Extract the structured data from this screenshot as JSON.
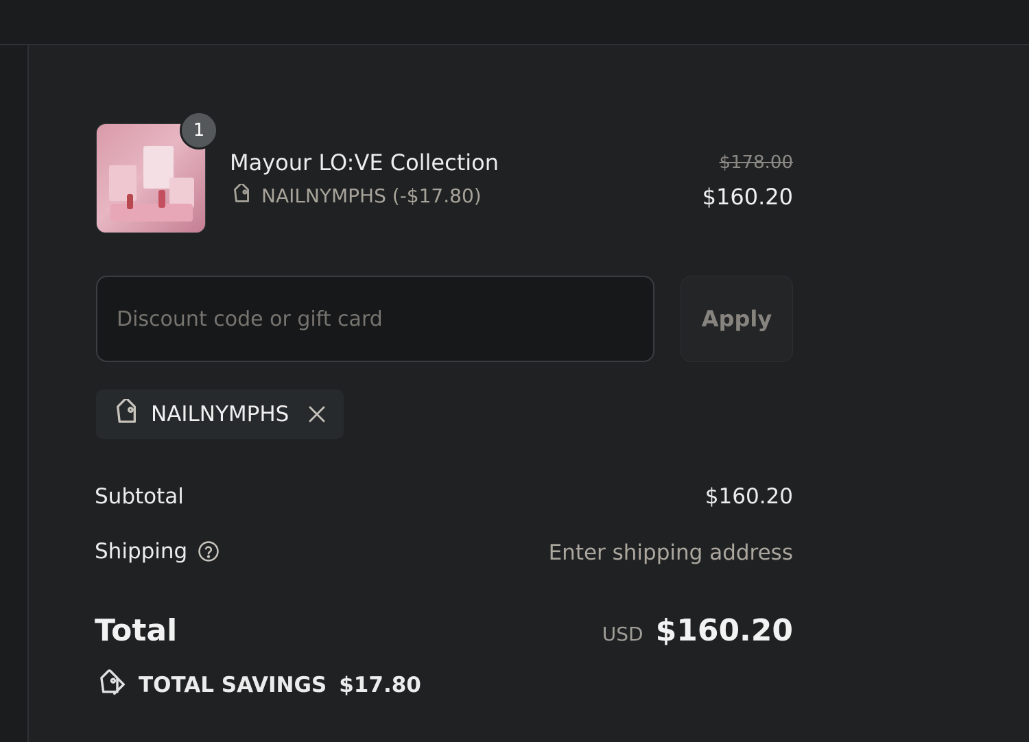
{
  "line_item": {
    "quantity": "1",
    "name": "Mayour LO:VE Collection",
    "discount_note": "NAILNYMPHS (-$17.80)",
    "original_price": "$178.00",
    "price": "$160.20"
  },
  "discount": {
    "placeholder": "Discount code or gift card",
    "value": "",
    "apply_label": "Apply"
  },
  "applied_code": {
    "code": "NAILNYMPHS"
  },
  "summary": {
    "subtotal_label": "Subtotal",
    "subtotal_value": "$160.20",
    "shipping_label": "Shipping",
    "shipping_value": "Enter shipping address",
    "total_label": "Total",
    "total_currency": "USD",
    "total_value": "$160.20",
    "savings_label": "TOTAL SAVINGS",
    "savings_value": "$17.80"
  },
  "icons": {
    "discount_tag": "tag-icon",
    "remove": "close-icon",
    "help": "question-circle-icon",
    "savings": "tags-icon"
  }
}
